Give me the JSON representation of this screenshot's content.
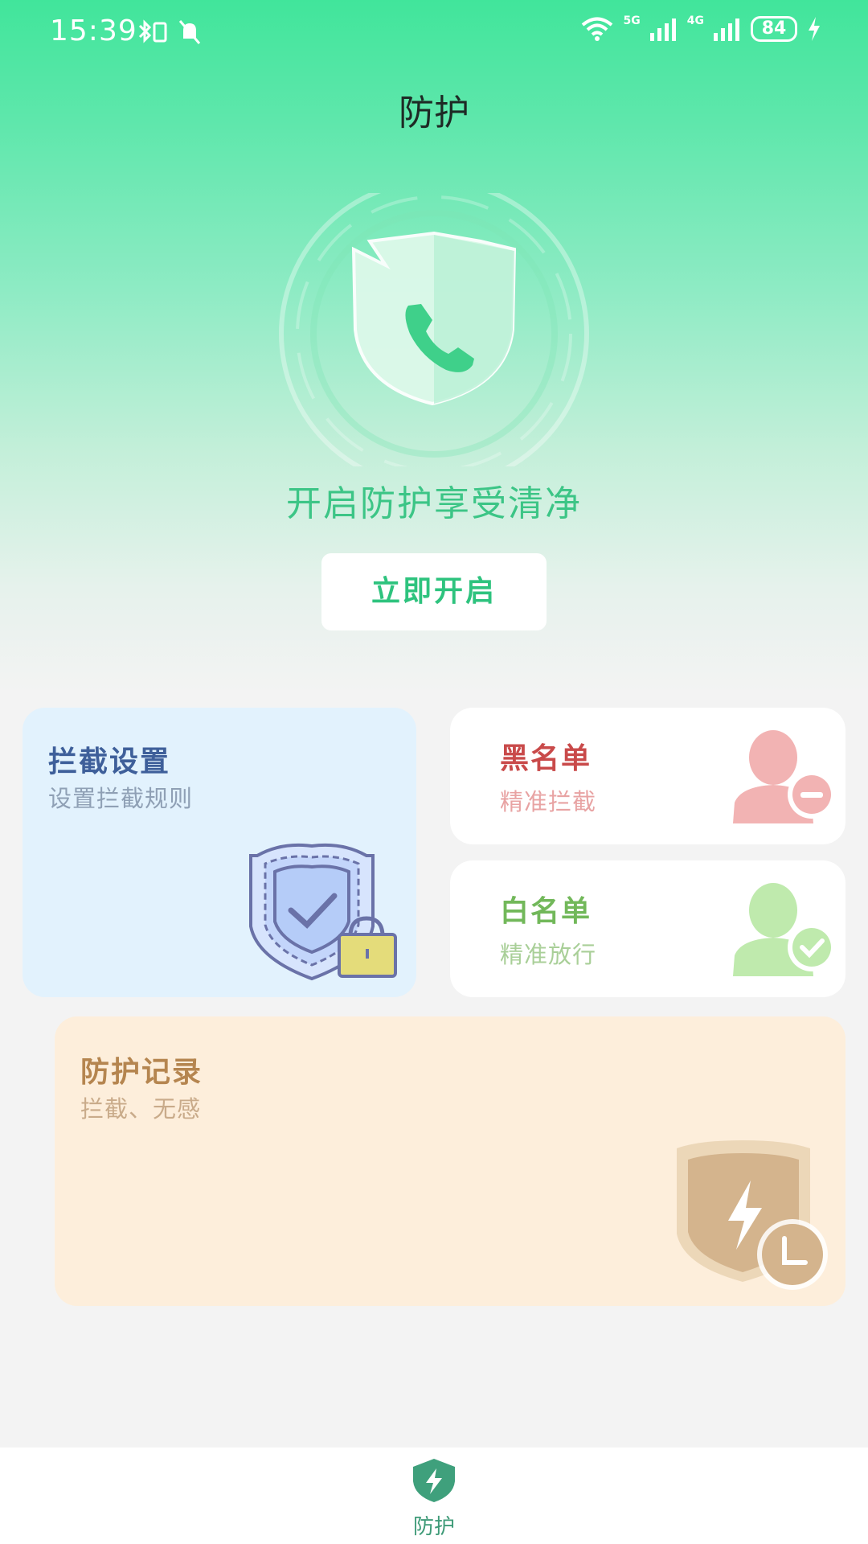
{
  "status_bar": {
    "time": "15:39",
    "net1": "5G",
    "net2": "4G",
    "battery": "84"
  },
  "header": {
    "title": "防护"
  },
  "hero": {
    "slogan": "开启防护享受清净",
    "button_label": "立即开启"
  },
  "cards": {
    "intercept": {
      "title": "拦截设置",
      "subtitle": "设置拦截规则"
    },
    "blacklist": {
      "title": "黑名单",
      "subtitle": "精准拦截"
    },
    "whitelist": {
      "title": "白名单",
      "subtitle": "精准放行"
    },
    "records": {
      "title": "防护记录",
      "subtitle": "拦截、无感"
    }
  },
  "bottom_nav": {
    "items": [
      {
        "label": "防护",
        "icon": "shield-bolt-icon",
        "active": true
      }
    ]
  },
  "colors": {
    "accent": "#3cc586",
    "intercept_title": "#3e5f9a",
    "black_title": "#c94a4a",
    "white_title": "#72b85a",
    "record_title": "#b5854f"
  }
}
